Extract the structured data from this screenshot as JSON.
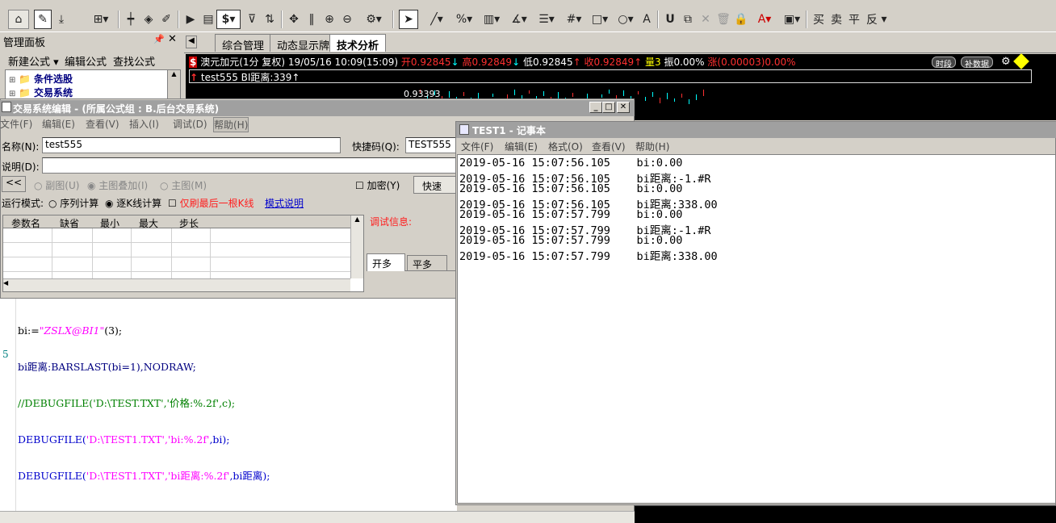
{
  "colors": {
    "accent_red": "#ff2020",
    "up_red": "#ff3030",
    "down_cyan": "#00ffff",
    "chart_bg": "#000000",
    "titlebar": "#a0a0a0",
    "link_blue": "#0000cc"
  },
  "toolbar": {
    "icons": [
      "home-icon",
      "draw-icon",
      "download-icon",
      "grid-icon",
      "kline-icon",
      "diamond-icon",
      "edit-icon",
      "play-icon",
      "doc-icon",
      "dollar-icon",
      "filter-icon",
      "swap-icon",
      "move-icon",
      "bars-icon",
      "zoom-in-icon",
      "zoom-out-icon",
      "gear-icon",
      "cursor-icon",
      "line-icon",
      "percent-icon",
      "ruler-icon",
      "angle-icon",
      "hbars-icon",
      "hash-icon",
      "rect-icon",
      "circle-icon",
      "font-icon",
      "magnet-icon",
      "copy-icon",
      "close-icon",
      "trash-icon",
      "lock-icon",
      "text-color-icon",
      "save-icon"
    ],
    "buy_label": "买",
    "sell_label": "卖",
    "flat_label": "平",
    "reverse_label": "反"
  },
  "manage_panel": {
    "title": "管理面板",
    "new_formula": "新建公式",
    "edit_formula": "编辑公式",
    "find_formula": "查找公式",
    "tree_item_1": "条件选股",
    "tree_item_2": "交易系统"
  },
  "chart_tabs": [
    "综合管理",
    "动态显示牌",
    "技术分析"
  ],
  "chart": {
    "symbol": "澳元加元(1分 复权)",
    "datetime": "19/05/16 10:09(15:09)",
    "open": "开0.92845",
    "high": "高0.92849",
    "low": "低0.92845",
    "close": "收0.92849",
    "vol": "量3",
    "amp": "振0.00%",
    "chg": "涨(0.00003)0.00%",
    "indicator": "test555 BI距离:339",
    "price_label": "0.93393",
    "btn_time": "时段",
    "btn_fill": "补数据"
  },
  "editor": {
    "title": "交易系统编辑 - (所属公式组 : B.后台交易系统)",
    "menu": [
      "文件(F)",
      "编辑(E)",
      "查看(V)",
      "插入(I)",
      "调试(D)",
      "帮助(H)"
    ],
    "name_label": "名称(N):",
    "name_value": "test555",
    "shortcut_label": "快捷码(Q):",
    "shortcut_value": "TEST555",
    "desc_label": "说明(D):",
    "desc_value": "",
    "back_label": "<<",
    "sub_chart": "副图(U)",
    "main_overlay": "主图叠加(I)",
    "main_chart": "主图(M)",
    "encrypt": "加密(Y)",
    "quick": "快速",
    "run_mode": "运行模式:",
    "seq": "序列计算",
    "bar_by_bar": "逐K线计算",
    "last_only": "仅刷最后一根K线",
    "mode_help": "模式说明",
    "param_headers": [
      "参数名",
      "缺省",
      "最小",
      "最大",
      "步长"
    ],
    "debug_label": "调试信息:",
    "action_tabs": [
      "开多",
      "平多"
    ],
    "code_lines": [
      "bi:=\"ZSLX@BI1\"(3);",
      "bi距离:BARSLAST(bi=1),NODRAW;",
      "//DEBUGFILE('D:\\TEST.TXT','价格:%.2f',c);",
      "DEBUGFILE('D:\\TEST1.TXT','bi:%.2f',bi);",
      "DEBUGFILE('D:\\TEST1.TXT','bi距离:%.2f',bi距离);"
    ],
    "line_marker": "5"
  },
  "notepad": {
    "title": "TEST1 - 记事本",
    "menu": [
      "文件(F)",
      "编辑(E)",
      "格式(O)",
      "查看(V)",
      "帮助(H)"
    ],
    "lines": [
      {
        "ts": "2019-05-16 15:07:56.105",
        "val": "bi:0.00"
      },
      {
        "ts": "2019-05-16 15:07:56.105",
        "val": "bi距离:-1.#R"
      },
      {
        "ts": "2019-05-16 15:07:56.105",
        "val": "bi:0.00"
      },
      {
        "ts": "2019-05-16 15:07:56.105",
        "val": "bi距离:338.00"
      },
      {
        "ts": "2019-05-16 15:07:57.799",
        "val": "bi:0.00"
      },
      {
        "ts": "2019-05-16 15:07:57.799",
        "val": "bi距离:-1.#R"
      },
      {
        "ts": "2019-05-16 15:07:57.799",
        "val": "bi:0.00"
      },
      {
        "ts": "2019-05-16 15:07:57.799",
        "val": "bi距离:338.00"
      }
    ]
  }
}
